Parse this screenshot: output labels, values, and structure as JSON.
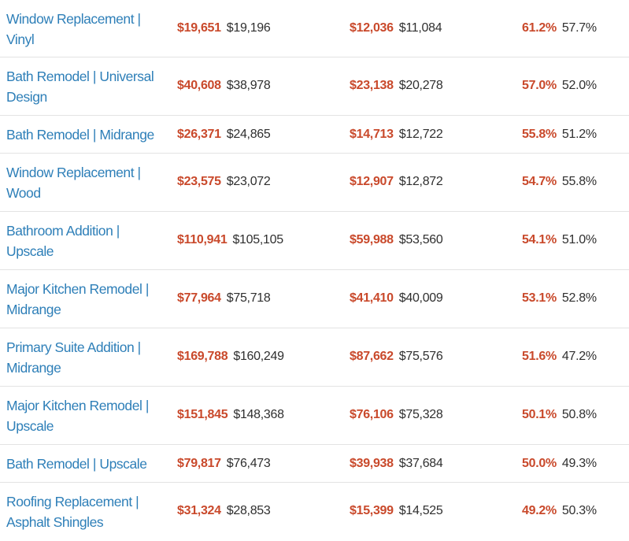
{
  "rows": [
    {
      "project": "Window Replacement | Vinyl",
      "cost_new": "$19,651",
      "cost_old": "$19,196",
      "resale_new": "$12,036",
      "resale_old": "$11,084",
      "recoup_new": "61.2%",
      "recoup_old": "57.7%"
    },
    {
      "project": "Bath Remodel | Universal Design",
      "cost_new": "$40,608",
      "cost_old": "$38,978",
      "resale_new": "$23,138",
      "resale_old": "$20,278",
      "recoup_new": "57.0%",
      "recoup_old": "52.0%"
    },
    {
      "project": "Bath Remodel | Midrange",
      "cost_new": "$26,371",
      "cost_old": "$24,865",
      "resale_new": "$14,713",
      "resale_old": "$12,722",
      "recoup_new": "55.8%",
      "recoup_old": "51.2%"
    },
    {
      "project": "Window Replacement | Wood",
      "cost_new": "$23,575",
      "cost_old": "$23,072",
      "resale_new": "$12,907",
      "resale_old": "$12,872",
      "recoup_new": "54.7%",
      "recoup_old": "55.8%"
    },
    {
      "project": "Bathroom Addition | Upscale",
      "cost_new": "$110,941",
      "cost_old": "$105,105",
      "resale_new": "$59,988",
      "resale_old": "$53,560",
      "recoup_new": "54.1%",
      "recoup_old": "51.0%"
    },
    {
      "project": "Major Kitchen Remodel | Midrange",
      "cost_new": "$77,964",
      "cost_old": "$75,718",
      "resale_new": "$41,410",
      "resale_old": "$40,009",
      "recoup_new": "53.1%",
      "recoup_old": "52.8%"
    },
    {
      "project": "Primary Suite Addition | Midrange",
      "cost_new": "$169,788",
      "cost_old": "$160,249",
      "resale_new": "$87,662",
      "resale_old": "$75,576",
      "recoup_new": "51.6%",
      "recoup_old": "47.2%"
    },
    {
      "project": "Major Kitchen Remodel | Upscale",
      "cost_new": "$151,845",
      "cost_old": "$148,368",
      "resale_new": "$76,106",
      "resale_old": "$75,328",
      "recoup_new": "50.1%",
      "recoup_old": "50.8%"
    },
    {
      "project": "Bath Remodel | Upscale",
      "cost_new": "$79,817",
      "cost_old": "$76,473",
      "resale_new": "$39,938",
      "resale_old": "$37,684",
      "recoup_new": "50.0%",
      "recoup_old": "49.3%"
    },
    {
      "project": "Roofing Replacement | Asphalt Shingles",
      "cost_new": "$31,324",
      "cost_old": "$28,853",
      "resale_new": "$15,399",
      "resale_old": "$14,525",
      "recoup_new": "49.2%",
      "recoup_old": "50.3%"
    }
  ],
  "colors": {
    "link": "#2e7fb8",
    "highlight": "#c9492b",
    "text": "#2f2f2f",
    "divider": "#e3e3e3"
  }
}
